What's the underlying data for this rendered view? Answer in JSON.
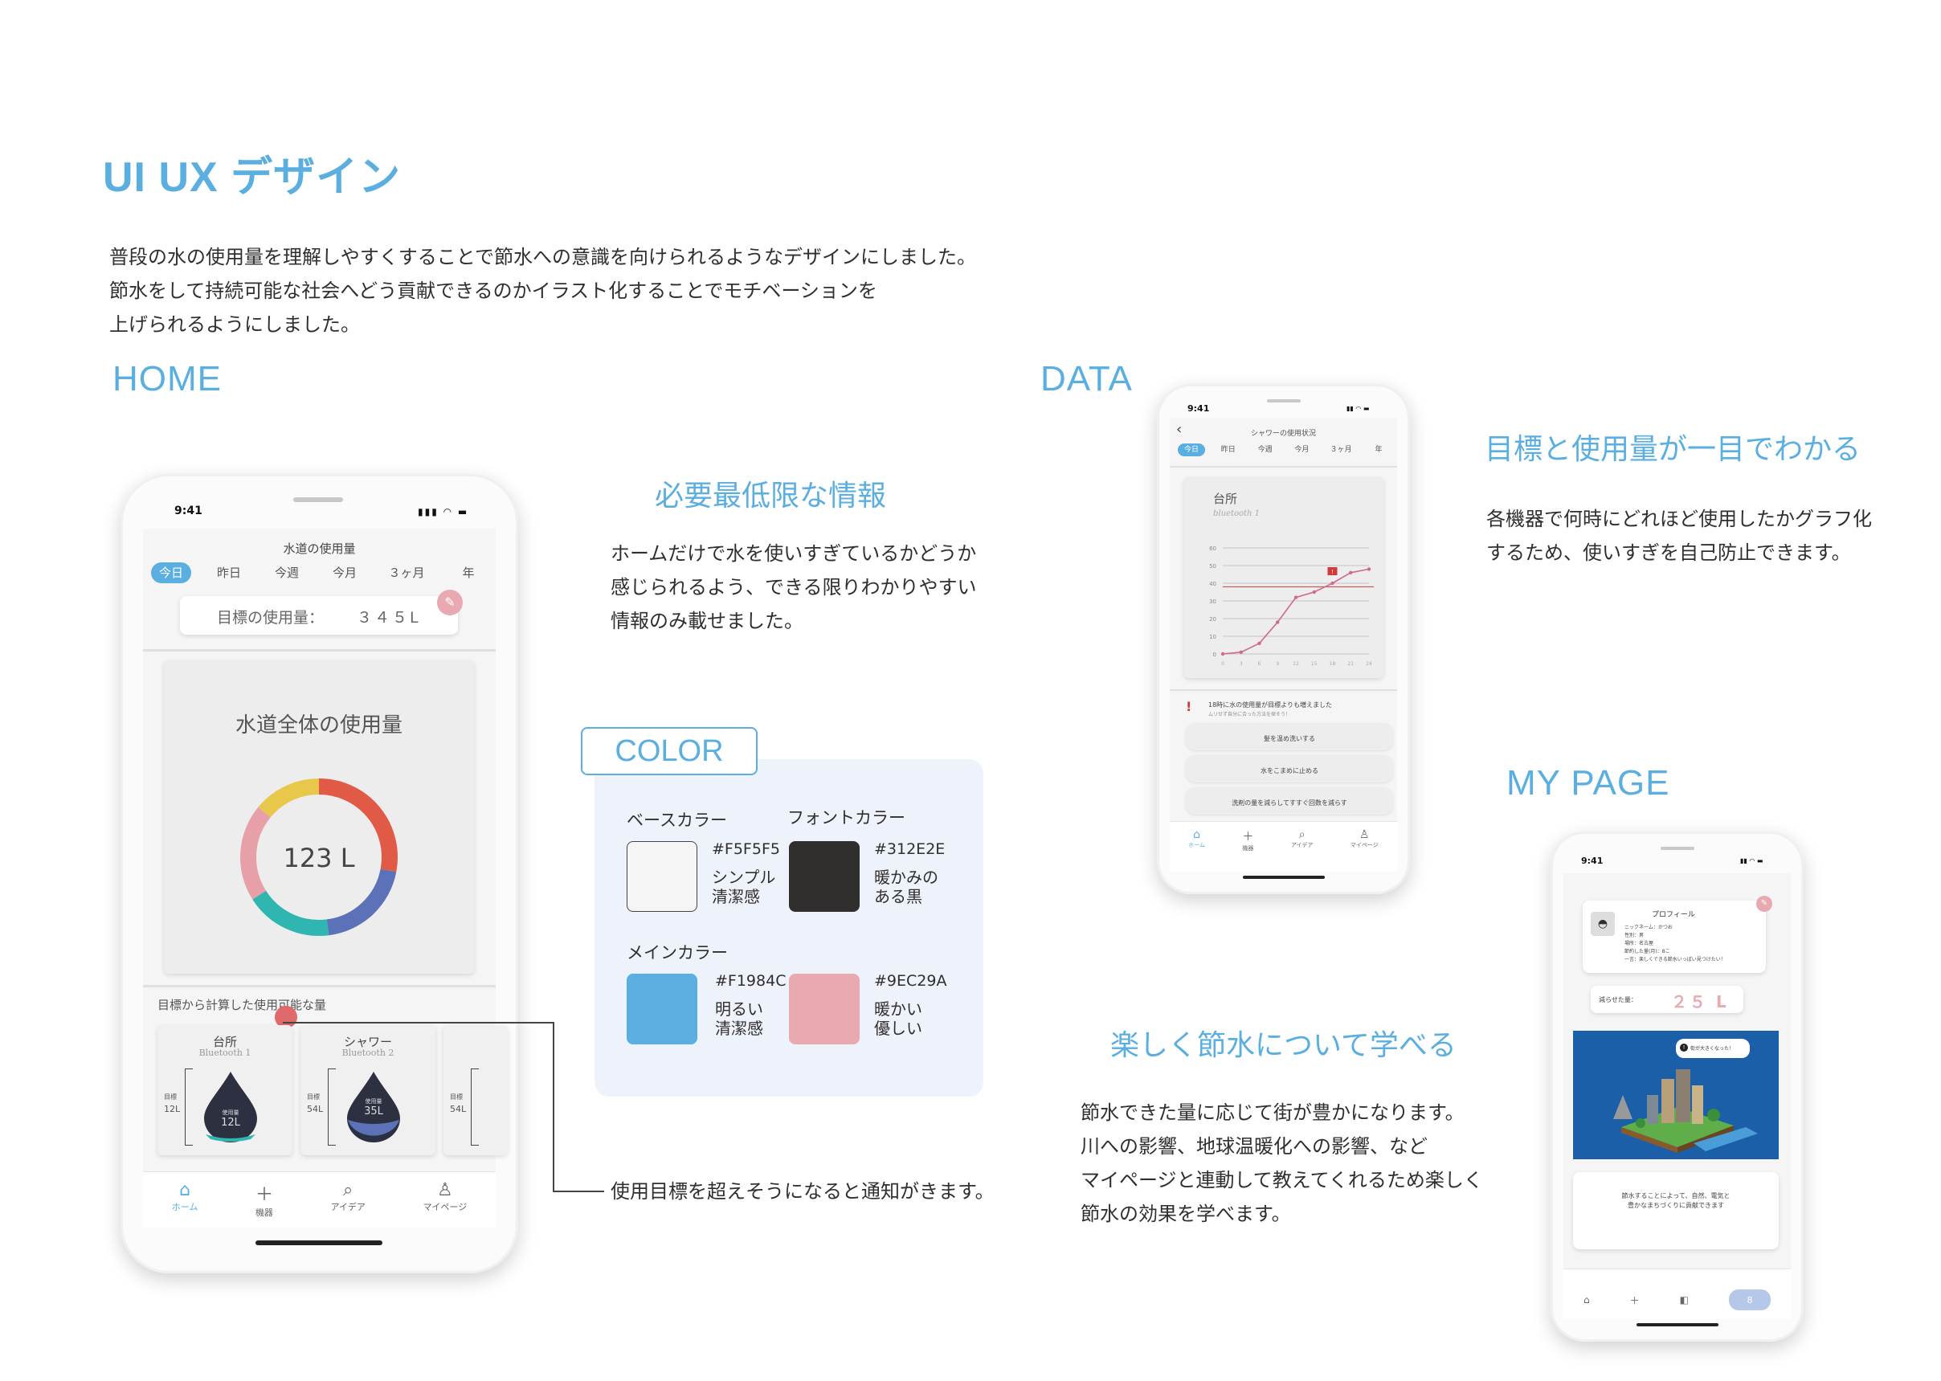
{
  "page": {
    "title": "UI UX デザイン",
    "intro": [
      "普段の水の使用量を理解しやすくすることで節水への意識を向けられるようなデザインにしました。",
      "節水をして持続可能な社会へどう貢献できるのかイラスト化することでモチベーションを",
      "上げられるようにしました。"
    ]
  },
  "sections": {
    "home": "HOME",
    "data": "DATA",
    "mypage": "MY PAGE",
    "color": "COLOR"
  },
  "home_desc": {
    "heading": "必要最低限な情報",
    "lines": [
      "ホームだけで水を使いすぎているかどうか",
      "感じられるよう、できる限りわかりやすい",
      "情報のみ載せました。"
    ],
    "notice": "使用目標を超えそうになると通知がきます。"
  },
  "data_desc": {
    "heading": "目標と使用量が一目でわかる",
    "lines": [
      "各機器で何時にどれほど使用したかグラフ化",
      "するため、使いすぎを自己防止できます。"
    ]
  },
  "mypage_desc": {
    "heading": "楽しく節水について学べる",
    "lines": [
      "節水できた量に応じて街が豊かになります。",
      "川への影響、地球温暖化への影響、など",
      "マイページと連動して教えてくれるため楽しく",
      "節水の効果を学べます。"
    ]
  },
  "colors": {
    "base_label": "ベースカラー",
    "font_label": "フォントカラー",
    "main_label": "メインカラー",
    "base": {
      "hex": "#F5F5F5",
      "desc1": "シンプル",
      "desc2": "清潔感"
    },
    "font": {
      "hex": "#312E2E",
      "desc1": "暖かみの",
      "desc2": "ある黒"
    },
    "main": {
      "hex": "#F1984C",
      "desc1": "明るい",
      "desc2": "清潔感"
    },
    "accent": {
      "hex": "#9EC29A",
      "desc1": "暖かい",
      "desc2": "優しい"
    },
    "swatch_base": "#F5F5F5",
    "swatch_font": "#312E2E",
    "swatch_main": "#5AAFE0",
    "swatch_accent": "#E8AAB0"
  },
  "home_phone": {
    "time": "9:41",
    "header": "水道の使用量",
    "tabs": [
      "今日",
      "昨日",
      "今週",
      "今月",
      "３ヶ月",
      "年"
    ],
    "goal_label": "目標の使用量：",
    "goal_value": "３４５L",
    "total_title": "水道全体の使用量",
    "total_value": "123 L",
    "donut": [
      {
        "color": "#e05a45",
        "value": 28
      },
      {
        "color": "#5b72b8",
        "value": 20
      },
      {
        "color": "#2fb6b0",
        "value": 18
      },
      {
        "color": "#e8a0a8",
        "value": 20
      },
      {
        "color": "#e8c84a",
        "value": 14
      }
    ],
    "possible_title": "目標から計算した使用可能な量",
    "devices": [
      {
        "name": "台所",
        "sub": "Bluetooth 1",
        "goal": "12L",
        "used_label": "使用量",
        "used": "12L"
      },
      {
        "name": "シャワー",
        "sub": "Bluetooth 2",
        "goal": "54L",
        "used_label": "使用量",
        "used": "35L"
      },
      {
        "goal": "54L"
      }
    ],
    "goal_mini": "目標",
    "nav": [
      "ホーム",
      "機器",
      "アイデア",
      "マイページ"
    ]
  },
  "data_phone": {
    "time": "9:41",
    "header": "シャワーの使用状況",
    "tabs": [
      "今日",
      "昨日",
      "今週",
      "今月",
      "３ヶ月",
      "年"
    ],
    "card_title": "台所",
    "card_sub": "bluetooth 1",
    "alert": "18時に水の使用量が目標よりも増えました",
    "alert_sub": "ムリせず自分に合った方法を探そう！",
    "tips": [
      "髪を温め洗いする",
      "水をこまめに止める",
      "洗剤の量を減らしてすすぐ回数を減らす"
    ],
    "nav": [
      "ホーム",
      "機器",
      "アイデア",
      "マイページ"
    ]
  },
  "chart_data": {
    "type": "line",
    "x": [
      0,
      3,
      6,
      9,
      12,
      15,
      18,
      21,
      24
    ],
    "values": [
      0,
      1,
      6,
      18,
      32,
      35,
      40,
      46,
      48
    ],
    "goal_line": 38,
    "yticks": [
      0,
      10,
      20,
      30,
      40,
      50,
      60
    ],
    "xticks": [
      "0",
      "3",
      "6",
      "9",
      "12",
      "15",
      "18",
      "21",
      "24"
    ],
    "ylim": [
      0,
      60
    ],
    "marker_label": "!"
  },
  "mypage_phone": {
    "time": "9:41",
    "profile_title": "プロフィール",
    "profile_lines": [
      "ニックネーム：かつお",
      "性別：男",
      "場所：名古屋",
      "節約した量(月)：8こ",
      "一言：楽しくできる節水いっぱい見つけたい！"
    ],
    "reduced_label": "減らせた量：",
    "reduced_value": "２５ L",
    "bubble": "街が大きくなった！",
    "info_lines": [
      "節水することによって、自然、電気と",
      "豊かなまちづくりに貢献できます"
    ],
    "badge": "8"
  }
}
